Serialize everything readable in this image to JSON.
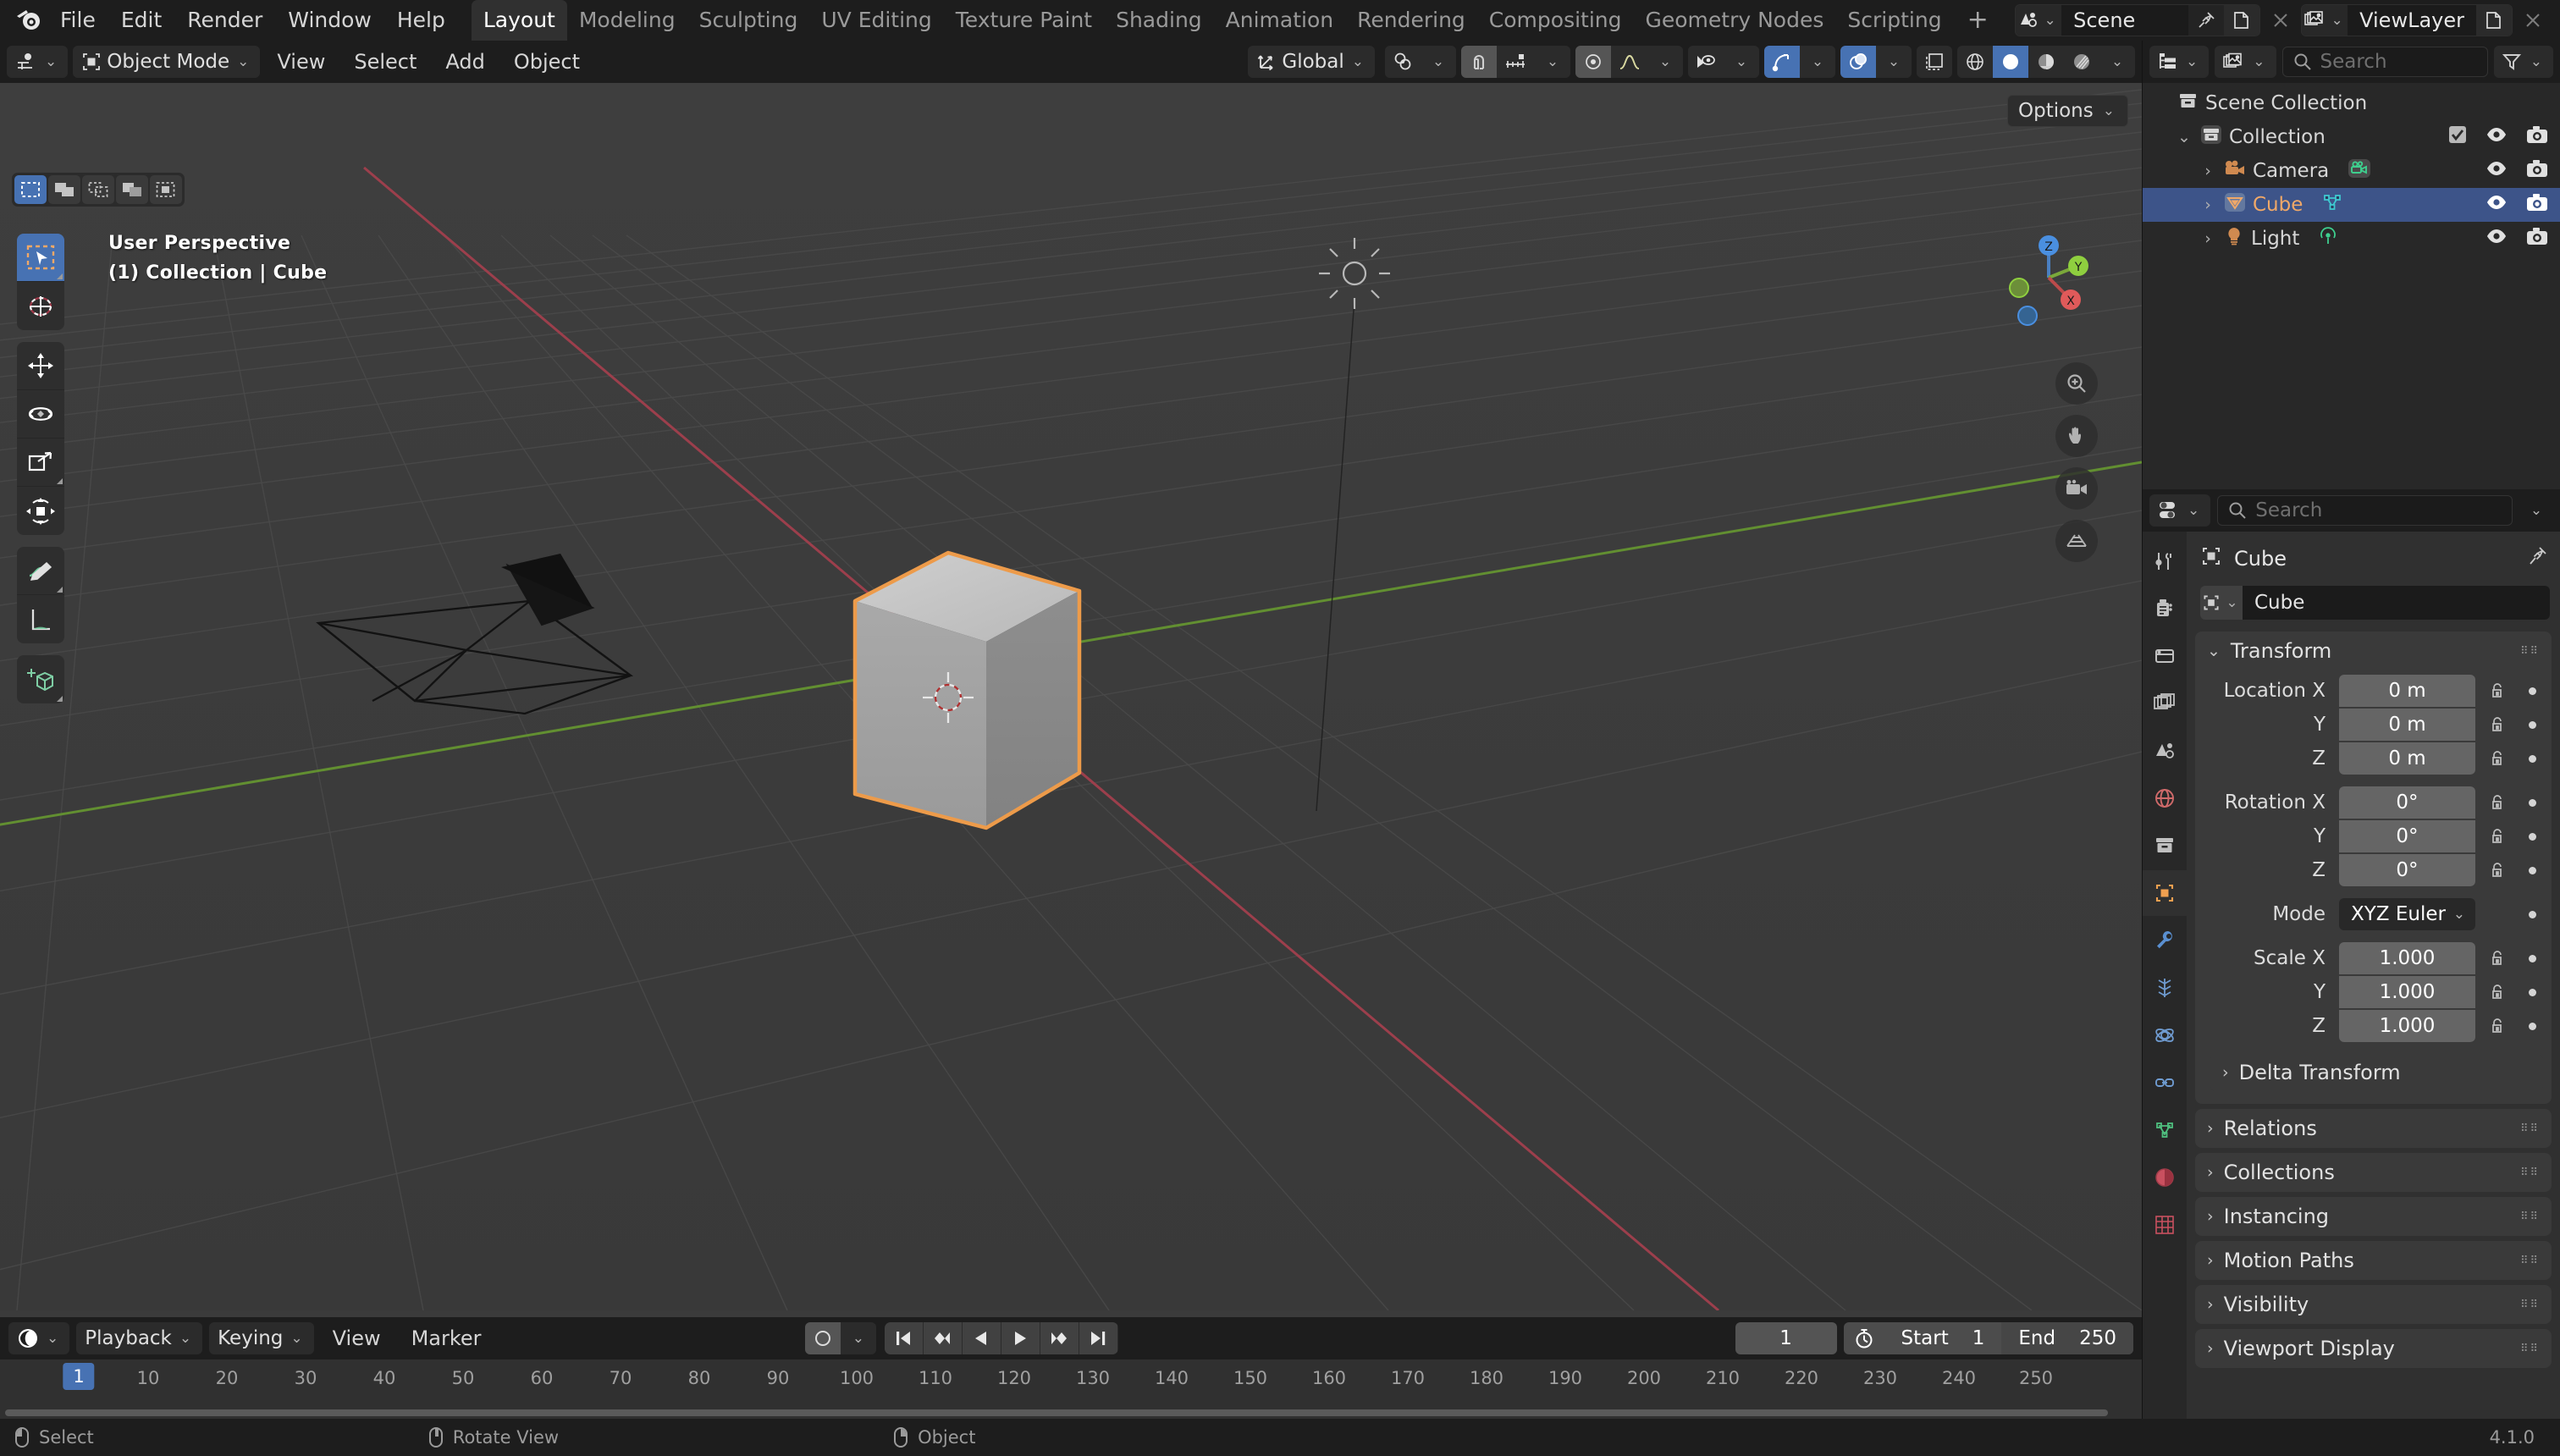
{
  "app": {
    "name": "Blender",
    "version": "4.1.0"
  },
  "topbar": {
    "menus": [
      "File",
      "Edit",
      "Render",
      "Window",
      "Help"
    ],
    "workspaces": [
      {
        "label": "Layout",
        "active": true
      },
      {
        "label": "Modeling",
        "active": false
      },
      {
        "label": "Sculpting",
        "active": false
      },
      {
        "label": "UV Editing",
        "active": false
      },
      {
        "label": "Texture Paint",
        "active": false
      },
      {
        "label": "Shading",
        "active": false
      },
      {
        "label": "Animation",
        "active": false
      },
      {
        "label": "Rendering",
        "active": false
      },
      {
        "label": "Compositing",
        "active": false
      },
      {
        "label": "Geometry Nodes",
        "active": false
      },
      {
        "label": "Scripting",
        "active": false
      }
    ],
    "add_workspace_label": "+",
    "scene": {
      "name": "Scene",
      "icon": "scene-icon",
      "new_label": "new-scene-icon",
      "unlink_label": "x-icon"
    },
    "viewlayer": {
      "name": "ViewLayer",
      "icon": "viewlayer-icon",
      "new_label": "new-viewlayer-icon",
      "remove_label": "x-icon"
    }
  },
  "viewport_header": {
    "editor_type": "editor-type-icon",
    "mode": "Object Mode",
    "menus": [
      "View",
      "Select",
      "Add",
      "Object"
    ],
    "transform_orientation": "Global",
    "snap_enabled": false,
    "proportional_edit_enabled": false,
    "options_label": "Options"
  },
  "viewport": {
    "perspective_label": "User Perspective",
    "scene_path_label": "(1) Collection | Cube",
    "select_modes": [
      "set",
      "extend",
      "subtract",
      "invert",
      "intersect"
    ],
    "active_select_mode": 0,
    "tools": [
      {
        "name": "tweak-tool",
        "label": "Tweak",
        "active": true
      },
      {
        "name": "cursor-tool",
        "label": "Cursor",
        "active": false
      },
      {
        "name": "move-tool",
        "label": "Move",
        "active": false
      },
      {
        "name": "rotate-tool",
        "label": "Rotate",
        "active": false
      },
      {
        "name": "scale-tool",
        "label": "Scale",
        "active": false
      },
      {
        "name": "transform-tool",
        "label": "Transform",
        "active": false
      },
      {
        "name": "annotate-tool",
        "label": "Annotate",
        "active": false
      },
      {
        "name": "measure-tool",
        "label": "Measure",
        "active": false
      },
      {
        "name": "add-cube-tool",
        "label": "Add Cube",
        "active": false
      }
    ],
    "gizmo_axes": [
      {
        "label": "Z",
        "color": "#4a8fe0"
      },
      {
        "label": "Y",
        "color": "#8fcf3f"
      },
      {
        "label": "X",
        "color": "#e05a5a"
      }
    ],
    "objects": [
      "Cube",
      "Camera",
      "Light"
    ],
    "selected_object": "Cube",
    "selection_outline_color": "#ed9b4a",
    "grid_color": "#4b4b4b",
    "x_axis_color": "#a8424f",
    "y_axis_color": "#6a9b35",
    "background_color": "#3b3b3b"
  },
  "outliner": {
    "display_mode": "View Layer",
    "search_placeholder": "Search",
    "filter_label": "filter-icon",
    "rows": [
      {
        "label": "Scene Collection",
        "icon": "collection-icon",
        "indent": 0,
        "selected": false,
        "expandable": false,
        "checkbox": false,
        "eye": false,
        "camera": false
      },
      {
        "label": "Collection",
        "icon": "collection-icon",
        "indent": 1,
        "selected": false,
        "expandable": true,
        "expanded": true,
        "checkbox": true,
        "eye": true,
        "camera": true
      },
      {
        "label": "Camera",
        "icon": "camera-obj-icon",
        "data_icon": "camera-data-icon",
        "indent": 2,
        "selected": false,
        "expandable": true,
        "expanded": false,
        "checkbox": false,
        "eye": true,
        "camera": true
      },
      {
        "label": "Cube",
        "icon": "mesh-obj-icon",
        "data_icon": "mesh-data-icon",
        "indent": 2,
        "selected": true,
        "expandable": true,
        "expanded": false,
        "checkbox": false,
        "eye": true,
        "camera": true
      },
      {
        "label": "Light",
        "icon": "light-obj-icon",
        "data_icon": "light-data-icon",
        "indent": 2,
        "selected": false,
        "expandable": true,
        "expanded": false,
        "checkbox": false,
        "eye": true,
        "camera": true
      }
    ]
  },
  "properties": {
    "search_placeholder": "Search",
    "tabs": [
      {
        "name": "tool-tab",
        "label": "Tool",
        "active": false
      },
      {
        "name": "render-tab",
        "label": "Render",
        "active": false
      },
      {
        "name": "output-tab",
        "label": "Output",
        "active": false
      },
      {
        "name": "viewlayer-tab",
        "label": "View Layer",
        "active": false
      },
      {
        "name": "scene-tab",
        "label": "Scene",
        "active": false
      },
      {
        "name": "world-tab",
        "label": "World",
        "active": false
      },
      {
        "name": "collection-tab",
        "label": "Collection",
        "active": false
      },
      {
        "name": "object-tab",
        "label": "Object",
        "active": true
      },
      {
        "name": "modifier-tab",
        "label": "Modifiers",
        "active": false
      },
      {
        "name": "particles-tab",
        "label": "Particles",
        "active": false
      },
      {
        "name": "physics-tab",
        "label": "Physics",
        "active": false
      },
      {
        "name": "constraints-tab",
        "label": "Object Constraints",
        "active": false
      },
      {
        "name": "data-tab",
        "label": "Object Data",
        "active": false
      },
      {
        "name": "material-tab",
        "label": "Material",
        "active": false
      },
      {
        "name": "texture-tab",
        "label": "Texture",
        "active": false
      }
    ],
    "breadcrumb_object": "Cube",
    "name_field_value": "Cube",
    "transform": {
      "title": "Transform",
      "rows": [
        {
          "label": "Location X",
          "value": "0 m",
          "pos": "first"
        },
        {
          "label": "Y",
          "value": "0 m",
          "pos": "mid"
        },
        {
          "label": "Z",
          "value": "0 m",
          "pos": "last"
        },
        {
          "label": "Rotation X",
          "value": "0°",
          "pos": "first"
        },
        {
          "label": "Y",
          "value": "0°",
          "pos": "mid"
        },
        {
          "label": "Z",
          "value": "0°",
          "pos": "last"
        }
      ],
      "mode_label": "Mode",
      "mode_value": "XYZ Euler",
      "scale_rows": [
        {
          "label": "Scale X",
          "value": "1.000",
          "pos": "first"
        },
        {
          "label": "Y",
          "value": "1.000",
          "pos": "mid"
        },
        {
          "label": "Z",
          "value": "1.000",
          "pos": "last"
        }
      ]
    },
    "panels": [
      {
        "label": "Delta Transform",
        "nested": true,
        "grip": false
      },
      {
        "label": "Relations",
        "nested": false,
        "grip": true
      },
      {
        "label": "Collections",
        "nested": false,
        "grip": true
      },
      {
        "label": "Instancing",
        "nested": false,
        "grip": true
      },
      {
        "label": "Motion Paths",
        "nested": false,
        "grip": true
      },
      {
        "label": "Visibility",
        "nested": false,
        "grip": true
      },
      {
        "label": "Viewport Display",
        "nested": false,
        "grip": true
      }
    ]
  },
  "timeline": {
    "editor_icon": "timeline-icon",
    "menus": [
      "Playback",
      "Keying",
      "View",
      "Marker"
    ],
    "auto_keying_label": "auto-keying-icon",
    "transport": [
      "jump-start",
      "prev-keyframe",
      "play-reverse",
      "play",
      "next-keyframe",
      "jump-end"
    ],
    "current_frame": "1",
    "timer_icon": "stopwatch-icon",
    "start_label": "Start",
    "start_value": "1",
    "end_label": "End",
    "end_value": "250",
    "playhead_frame": "1",
    "ticks": [
      "10",
      "20",
      "30",
      "40",
      "50",
      "60",
      "70",
      "80",
      "90",
      "100",
      "110",
      "120",
      "130",
      "140",
      "150",
      "160",
      "170",
      "180",
      "190",
      "200",
      "210",
      "220",
      "230",
      "240",
      "250"
    ]
  },
  "statusbar": {
    "items": [
      {
        "label": "Select",
        "mouse": "lft"
      },
      {
        "label": "Rotate View",
        "mouse": "mid"
      },
      {
        "label": "Object",
        "mouse": "rgt"
      }
    ],
    "version": "4.1.0"
  }
}
